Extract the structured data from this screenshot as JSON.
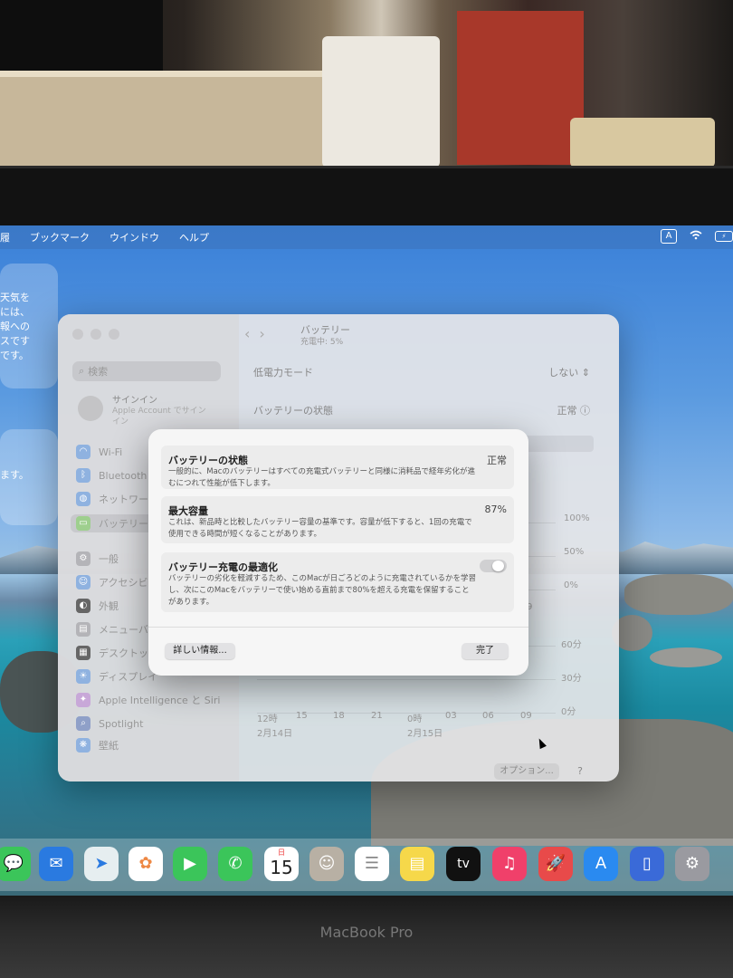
{
  "menubar": {
    "items": [
      "履",
      "ブックマーク",
      "ウインドウ",
      "ヘルプ"
    ],
    "input_badge": "A",
    "wifi_icon": "wifi-icon",
    "battery_icon": "battery-charging-icon"
  },
  "desktop_widgets": {
    "widget1_text": [
      "天気を",
      "には、",
      "報への",
      "スです",
      "です。"
    ],
    "widget2_text": "ます。"
  },
  "settings": {
    "search_placeholder": "検索",
    "signin_title": "サインイン",
    "signin_sub": "Apple Account でサインイン",
    "sidebar": [
      {
        "label": "Wi-Fi",
        "icon": "wifi-icon"
      },
      {
        "label": "Bluetooth",
        "icon": "bluetooth-icon"
      },
      {
        "label": "ネットワーク",
        "icon": "network-icon"
      },
      {
        "label": "バッテリー",
        "icon": "battery-icon",
        "selected": true
      },
      {
        "label": "一般",
        "icon": "gear-icon"
      },
      {
        "label": "アクセシビ",
        "icon": "accessibility-icon"
      },
      {
        "label": "外観",
        "icon": "appearance-icon"
      },
      {
        "label": "メニューバ",
        "icon": "menubar-icon"
      },
      {
        "label": "デスクトッ",
        "icon": "desktop-dock-icon"
      },
      {
        "label": "ディスプレイ",
        "icon": "display-icon"
      },
      {
        "label": "Apple Intelligence と Siri",
        "icon": "siri-icon"
      },
      {
        "label": "Spotlight",
        "icon": "spotlight-icon"
      },
      {
        "label": "壁紙",
        "icon": "wallpaper-icon"
      }
    ],
    "page_title": "バッテリー",
    "page_sub": "充電中: 5%",
    "low_power_label": "低電力モード",
    "low_power_value": "しない",
    "health_label": "バッテリーの状態",
    "health_value": "正常",
    "chart_y_top": [
      "100%",
      "50%",
      "0%"
    ],
    "chart_y_bottom": [
      "60分",
      "30分",
      "0分"
    ],
    "chart_x_ticks": [
      "12時",
      "15",
      "18",
      "21",
      "0時",
      "03",
      "06",
      "09"
    ],
    "chart_dates": [
      "2月14日",
      "2月15日"
    ],
    "partial_tick": "9",
    "options_label": "オプション...",
    "help_label": "?"
  },
  "modal": {
    "health_title": "バッテリーの状態",
    "health_value": "正常",
    "health_desc": "一般的に、Macのバッテリーはすべての充電式バッテリーと同様に消耗品で経年劣化が進むにつれて性能が低下します。",
    "capacity_title": "最大容量",
    "capacity_value": "87%",
    "capacity_desc": "これは、新品時と比較したバッテリー容量の基準です。容量が低下すると、1回の充電で使用できる時間が短くなることがあります。",
    "optimize_title": "バッテリー充電の最適化",
    "optimize_desc": "バッテリーの劣化を軽減するため、このMacが日ごろどのように充電されているかを学習し、次にこのMacをバッテリーで使い始める直前まで80%を超える充電を保留することがあります。",
    "more_info_label": "詳しい情報...",
    "done_label": "完了"
  },
  "dock": {
    "calendar_month": "日",
    "calendar_day": "15",
    "tv_label": "tv"
  },
  "device": {
    "brand": "MacBook Pro"
  }
}
